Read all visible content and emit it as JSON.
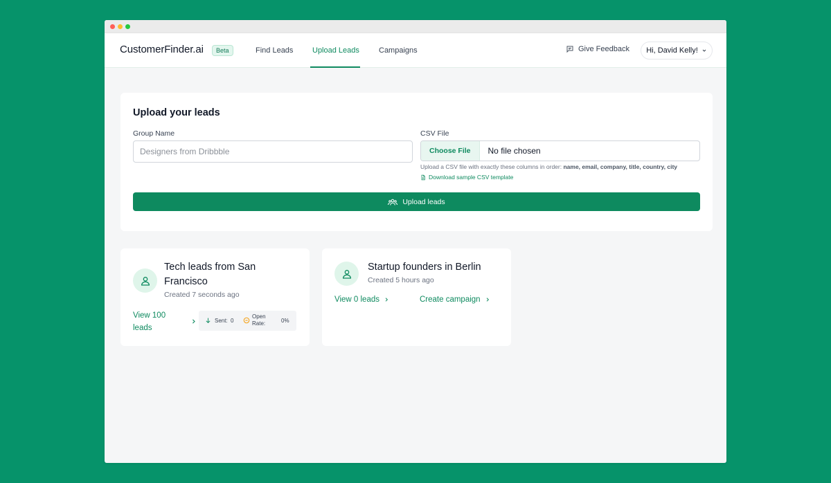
{
  "colors": {
    "background": "#06936a",
    "accent": "#0e8a5f",
    "accent_light": "#dff5ea",
    "warning": "#f59e0b"
  },
  "window": {
    "controls": [
      "close",
      "minimize",
      "maximize"
    ]
  },
  "header": {
    "brand": "CustomerFinder.ai",
    "badge": "Beta",
    "nav": [
      {
        "label": "Find Leads",
        "active": false
      },
      {
        "label": "Upload Leads",
        "active": true
      },
      {
        "label": "Campaigns",
        "active": false
      }
    ],
    "feedback_label": "Give Feedback",
    "feedback_icon": "chat-bubble-icon",
    "user_label": "Hi, David Kelly!"
  },
  "upload": {
    "title": "Upload your leads",
    "group_label": "Group Name",
    "group_placeholder": "Designers from Dribbble",
    "group_value": "",
    "csv_label": "CSV File",
    "choose_label": "Choose File",
    "no_file": "No file chosen",
    "help_prefix": "Upload a CSV file with exactly these columns in order: ",
    "help_columns": "name, email, company, title, country, city",
    "sample_link": "Download sample CSV template",
    "button_label": "Upload leads",
    "button_icon": "users-icon"
  },
  "lead_groups": [
    {
      "title_line1": "Tech leads from San",
      "title_line2": "Francisco",
      "created": "Created 7 seconds ago",
      "view_line1": "View 100",
      "view_line2": "leads",
      "sent_label": "Sent:",
      "sent_value": "0",
      "open_rate_line1": "Open",
      "open_rate_line2": "Rate:",
      "open_rate_value": "0%"
    },
    {
      "title": "Startup founders in Berlin",
      "created": "Created 5 hours ago",
      "view_label": "View 0 leads",
      "campaign_label": "Create campaign"
    }
  ]
}
